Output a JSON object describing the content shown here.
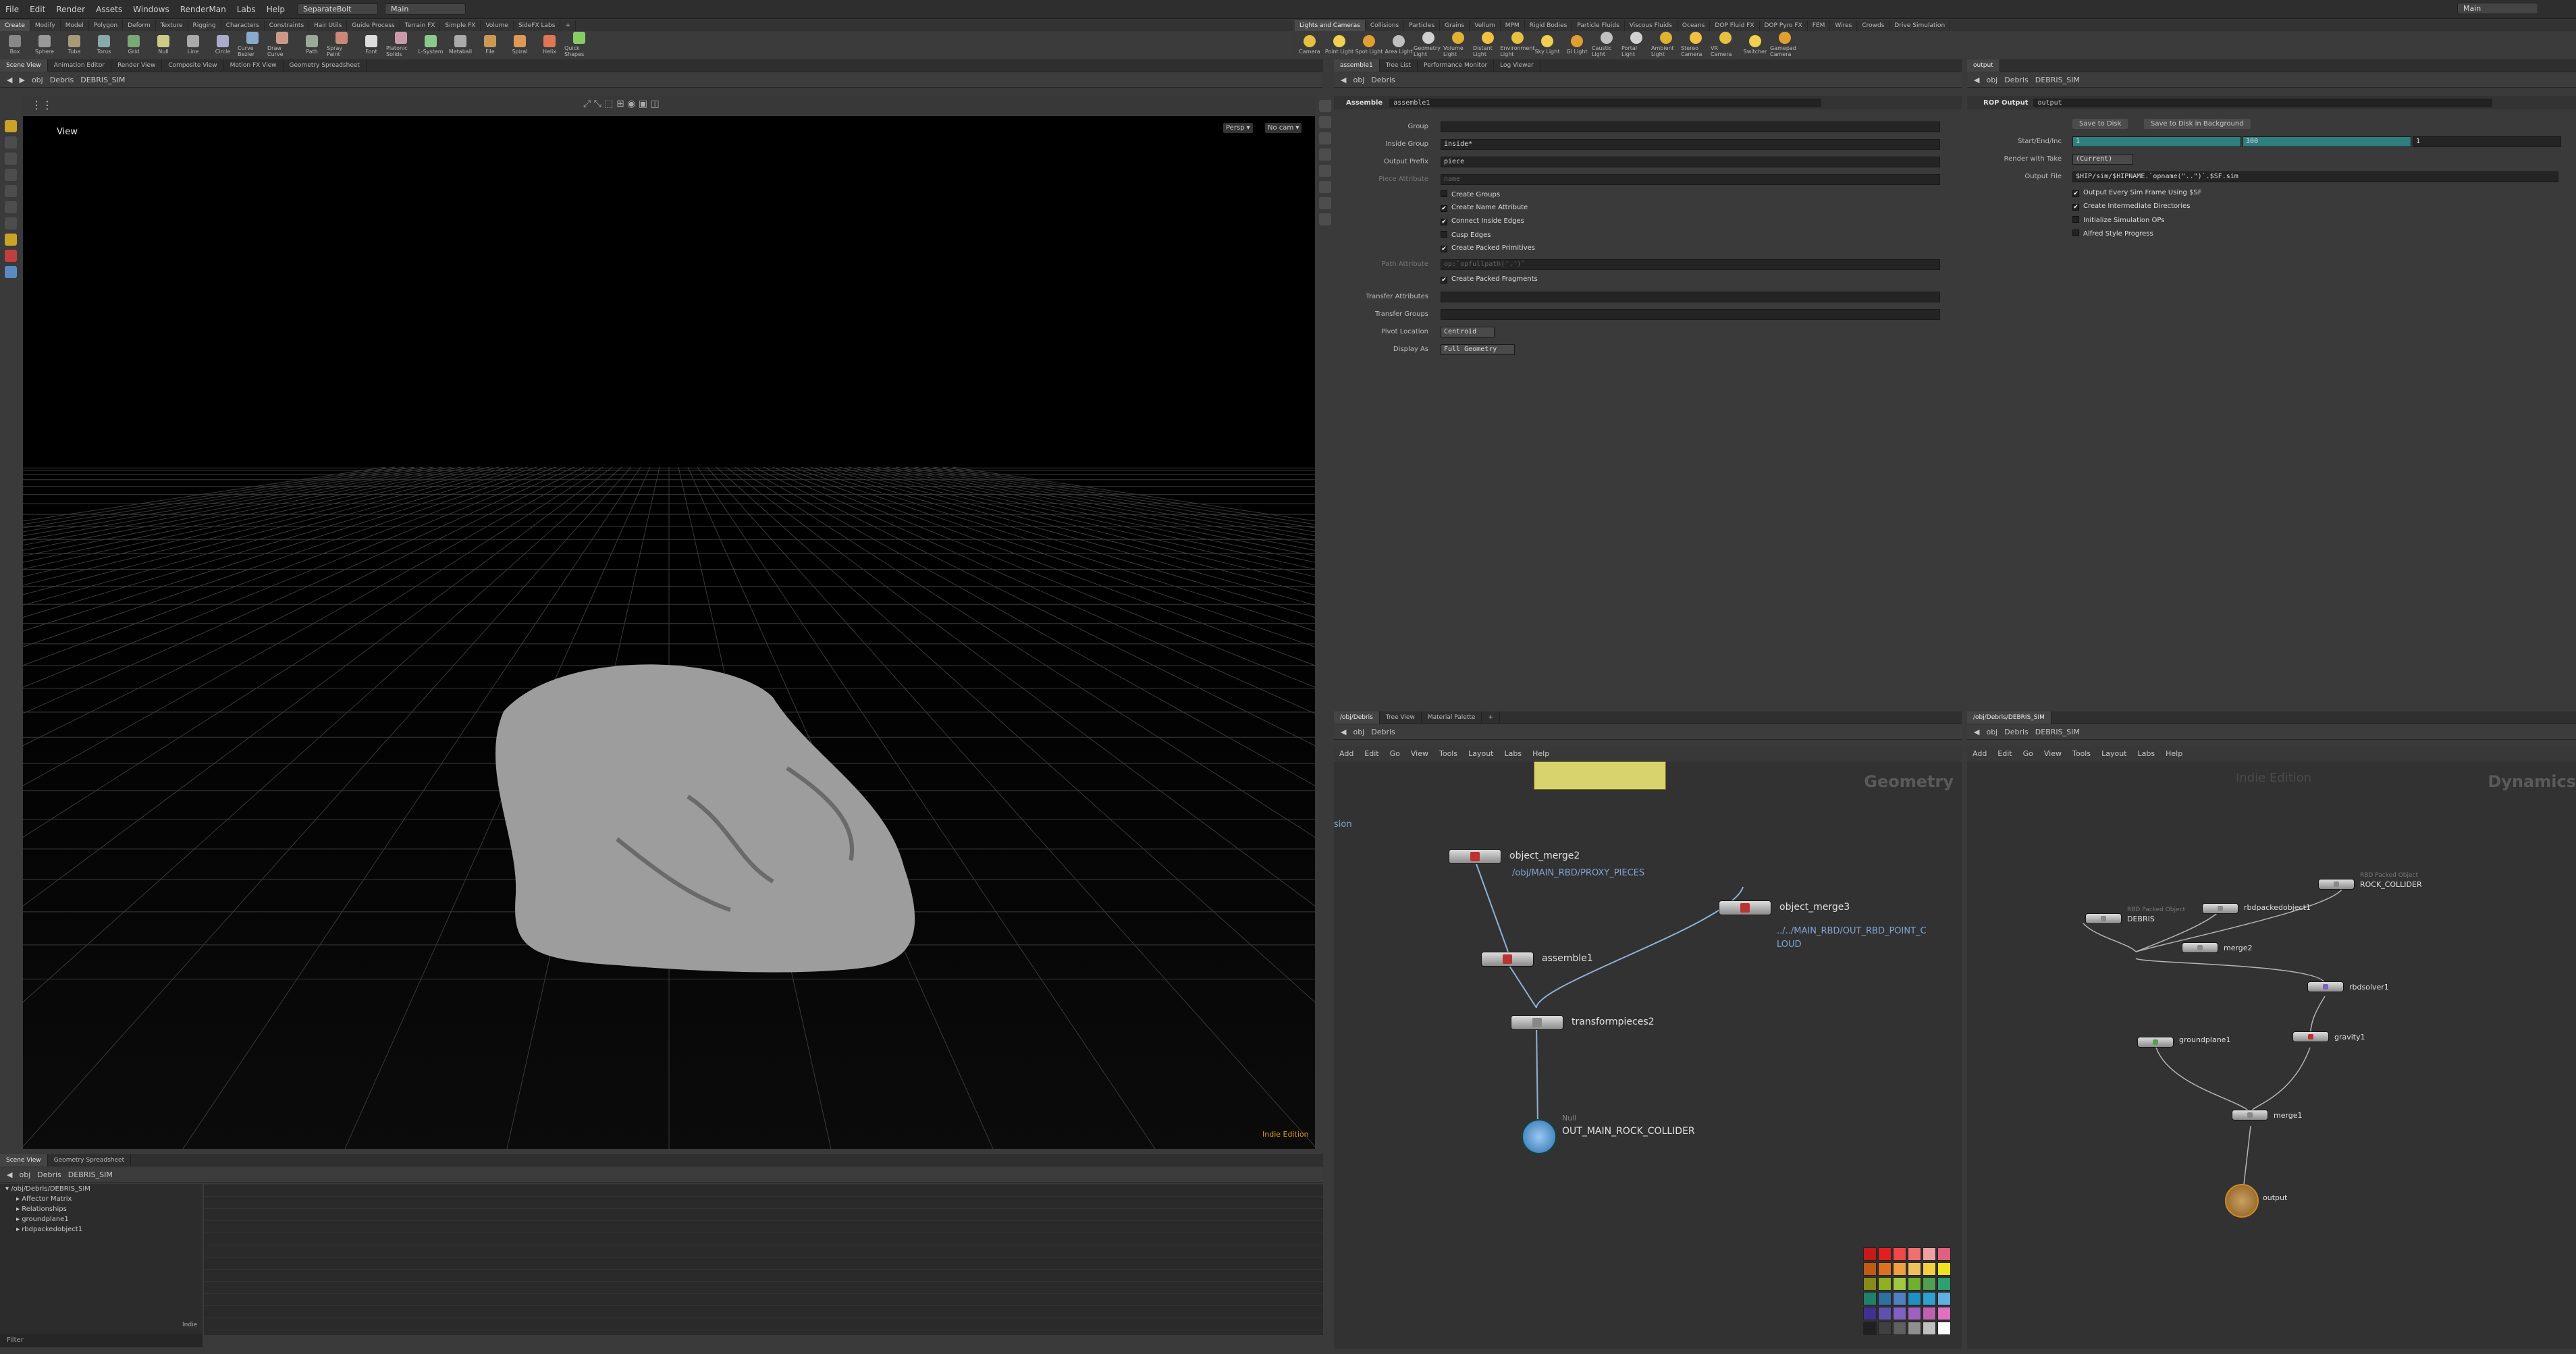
{
  "menubar": {
    "items": [
      "File",
      "Edit",
      "Render",
      "Assets",
      "Windows",
      "RenderMan",
      "Labs",
      "Help"
    ],
    "desktop": "SeparateBolt",
    "desktop2": "Main",
    "desktop3": "Main"
  },
  "shelf_tabs_left": [
    "Create",
    "Modify",
    "Model",
    "Polygon",
    "Deform",
    "Texture",
    "Rigging",
    "Characters",
    "Constraints",
    "Hair Utils",
    "Guide Process",
    "Terrain FX",
    "Simple FX",
    "Volume",
    "SideFX Labs",
    "+"
  ],
  "shelf_tabs_right": [
    "Lights and Cameras",
    "Collisions",
    "Particles",
    "Grains",
    "Vellum",
    "MPM",
    "Rigid Bodies",
    "Particle Fluids",
    "Viscous Fluids",
    "Oceans",
    "DOP Fluid FX",
    "DOP Pyro FX",
    "FEM",
    "Wires",
    "Crowds",
    "Drive Simulation"
  ],
  "tools_left": [
    "Box",
    "Sphere",
    "Tube",
    "Torus",
    "Grid",
    "Null",
    "Line",
    "Circle",
    "Curve Bezier",
    "Draw Curve",
    "Path",
    "Spray Paint",
    "Font",
    "Platonic Solids",
    "L-System",
    "Metaball",
    "File",
    "Spiral",
    "Helix",
    "Quick Shapes"
  ],
  "tools_right": [
    "Camera",
    "Point Light",
    "Spot Light",
    "Area Light",
    "Geometry Light",
    "Volume Light",
    "Distant Light",
    "Environment Light",
    "Sky Light",
    "GI Light",
    "Caustic Light",
    "Portal Light",
    "Ambient Light",
    "Stereo Camera",
    "VR Camera",
    "Switcher",
    "Gamepad Camera"
  ],
  "viewer": {
    "tabs": [
      "Scene View",
      "Animation Editor",
      "Render View",
      "Composite View",
      "Motion FX View",
      "Geometry Spreadsheet"
    ],
    "path": [
      "obj",
      "Debris",
      "DEBRIS_SIM"
    ],
    "label": "View",
    "persp": "Persp ▾",
    "cam": "No cam ▾",
    "edition": "Indie Edition"
  },
  "parm": {
    "tabs": [
      "assemble1",
      "Tree List",
      "Performance Monitor",
      "Log Viewer"
    ],
    "path": [
      "obj",
      "Debris"
    ],
    "node_type": "Assemble",
    "node_name": "assemble1",
    "fields": [
      {
        "label": "Group",
        "value": ""
      },
      {
        "label": "Inside Group",
        "value": "inside*"
      },
      {
        "label": "Output Prefix",
        "value": "piece"
      },
      {
        "label": "Piece Attribute",
        "value": "name"
      }
    ],
    "checks1": [
      {
        "label": "Create Groups",
        "on": false
      },
      {
        "label": "Create Name Attribute",
        "on": true
      },
      {
        "label": "Connect Inside Edges",
        "on": true
      },
      {
        "label": "Cusp Edges",
        "on": false
      },
      {
        "label": "Create Packed Primitives",
        "on": true
      }
    ],
    "path_attr_label": "Path Attribute",
    "path_attr_value": "op:`opfullpath('.')`",
    "check_fragments": "Create Packed Fragments",
    "transfer_attr": "Transfer Attributes",
    "transfer_groups": "Transfer Groups",
    "pivot_label": "Pivot Location",
    "pivot_value": "Centroid",
    "display_label": "Display As",
    "display_value": "Full Geometry"
  },
  "rop": {
    "tabs": [
      "output"
    ],
    "path": [
      "obj",
      "Debris",
      "DEBRIS_SIM"
    ],
    "node_type": "ROP Output",
    "node_name": "output",
    "save_btn": "Save to Disk",
    "save_bg_btn": "Save to Disk in Background",
    "range_label": "Start/End/Inc",
    "range": [
      "1",
      "300",
      "1"
    ],
    "take_label": "Render with Take",
    "take_value": "(Current)",
    "file_label": "Output File",
    "file_value": "$HIP/sim/$HIPNAME.`opname(\"..\")`.$SF.sim",
    "checks": [
      {
        "label": "Output Every Sim Frame Using $SF",
        "on": true
      },
      {
        "label": "Create Intermediate Directories",
        "on": true
      },
      {
        "label": "Initialize Simulation OPs",
        "on": false
      },
      {
        "label": "Alfred Style Progress",
        "on": false
      }
    ]
  },
  "network_mid": {
    "tabs": [
      "/obj/Debris",
      "Tree View",
      "Material Palette",
      "+"
    ],
    "path": [
      "obj",
      "Debris"
    ],
    "menus": [
      "Add",
      "Edit",
      "Go",
      "View",
      "Tools",
      "Layout",
      "Labs",
      "Help"
    ],
    "context": "Geometry",
    "edge_text": "sion",
    "nodes": [
      {
        "name": "object_merge2",
        "sub": "/obj/MAIN_RBD/PROXY_PIECES"
      },
      {
        "name": "object_merge3",
        "sub": "../../MAIN_RBD/OUT_RBD_POINT_C",
        "sub2": "LOUD"
      },
      {
        "name": "assemble1"
      },
      {
        "name": "transformpieces2"
      },
      {
        "name": "OUT_MAIN_ROCK_COLLIDER",
        "type": "Null"
      }
    ],
    "palette": [
      "#c41a1a",
      "#e02020",
      "#f04848",
      "#f07070",
      "#f0a0a0",
      "#e06080",
      "#c05a14",
      "#e07020",
      "#f0a040",
      "#f0c060",
      "#f0d040",
      "#f0e020",
      "#8a8a1a",
      "#90b020",
      "#a0c840",
      "#70b030",
      "#50a050",
      "#30a070",
      "#20806a",
      "#3070a0",
      "#5080c0",
      "#2090c0",
      "#30a0d0",
      "#60b0e0",
      "#403090",
      "#6050b0",
      "#8060c0",
      "#a060c0",
      "#c060b0",
      "#e070c0",
      "#202020",
      "#404040",
      "#606060",
      "#909090",
      "#c0c0c0",
      "#ffffff"
    ]
  },
  "network_right": {
    "tabs": [
      "/obj/Debris/DEBRIS_SIM"
    ],
    "path": [
      "obj",
      "Debris",
      "DEBRIS_SIM"
    ],
    "menus": [
      "Add",
      "Edit",
      "Go",
      "View",
      "Tools",
      "Layout",
      "Labs",
      "Help"
    ],
    "watermark": "Indie Edition",
    "context": "Dynamics",
    "nodes": [
      {
        "name": "DEBRIS",
        "type": "RBD Packed Object"
      },
      {
        "name": "rbdpackedobject1"
      },
      {
        "name": "ROCK_COLLIDER",
        "type": "RBD Packed Object"
      },
      {
        "name": "merge2"
      },
      {
        "name": "rbdsolver1"
      },
      {
        "name": "gravity1"
      },
      {
        "name": "groundplane1"
      },
      {
        "name": "merge1"
      },
      {
        "name": "output"
      }
    ]
  },
  "spreadsheet": {
    "tabs": [
      "Scene View",
      "Geometry Spreadsheet"
    ],
    "path": [
      "obj",
      "Debris",
      "DEBRIS_SIM"
    ],
    "tree": [
      "/obj/Debris/DEBRIS_SIM",
      "Affector Matrix",
      "Relationships",
      "groundplane1",
      "rbdpackedobject1"
    ],
    "filter": "Filter",
    "indie": "Indie"
  }
}
